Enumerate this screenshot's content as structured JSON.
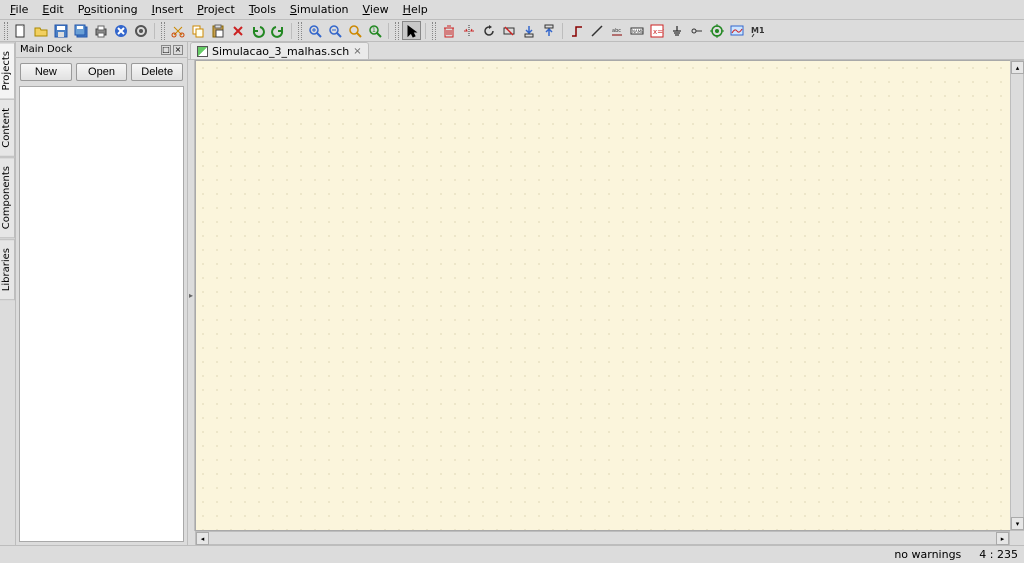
{
  "menu": {
    "file": "File",
    "edit": "Edit",
    "positioning": "Positioning",
    "insert": "Insert",
    "project": "Project",
    "tools": "Tools",
    "simulation": "Simulation",
    "view": "View",
    "help": "Help"
  },
  "dock": {
    "title": "Main Dock",
    "new_label": "New",
    "open_label": "Open",
    "delete_label": "Delete"
  },
  "side_tabs": {
    "projects": "Projects",
    "content": "Content",
    "components": "Components",
    "libraries": "Libraries"
  },
  "document": {
    "tab_label": "Simulacao_3_malhas.sch"
  },
  "status": {
    "warnings": "no warnings",
    "coords": "4 : 235"
  },
  "icons": {
    "new": "new-file-icon",
    "open": "open-file-icon",
    "save": "save-icon",
    "saveall": "save-all-icon",
    "print": "print-icon",
    "close": "close-doc-icon",
    "settings": "settings-icon",
    "undo": "undo-icon",
    "redo": "redo-icon",
    "cut": "cut-icon",
    "copy": "copy-icon",
    "paste": "paste-icon",
    "delete": "delete-icon",
    "zoom_in": "zoom-in-icon",
    "zoom_out": "zoom-out-icon",
    "zoom_fit": "zoom-fit-icon",
    "zoom_1": "zoom-1-icon",
    "pointer": "pointer-icon",
    "delete_tool": "delete-tool-icon",
    "mirror": "mirror-icon",
    "rotate": "rotate-icon",
    "activate": "activate-toggle-icon",
    "wire": "wire-icon",
    "label": "wire-label-icon",
    "equation": "equation-icon",
    "ground": "ground-icon",
    "port": "port-icon",
    "simulate": "simulate-icon",
    "display": "data-display-icon",
    "marker": "marker-icon",
    "line": "line-icon",
    "name_tool": "name-tool-icon",
    "misc": "misc-icon"
  }
}
